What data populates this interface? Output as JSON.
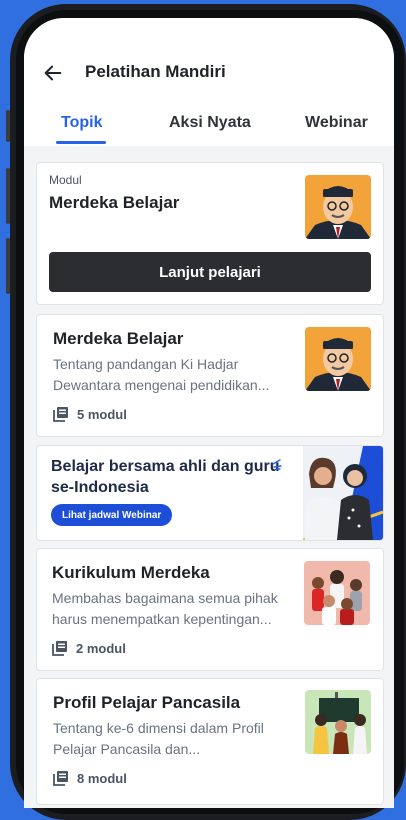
{
  "header": {
    "title": "Pelatihan Mandiri",
    "tabs": [
      {
        "label": "Topik",
        "active": true
      },
      {
        "label": "Aksi Nyata",
        "active": false
      },
      {
        "label": "Webinar",
        "active": false
      }
    ]
  },
  "continue_card": {
    "label": "Modul",
    "title": "Merdeka Belajar",
    "button_label": "Lanjut pelajari"
  },
  "topics": [
    {
      "title": "Merdeka Belajar",
      "description": "Tentang pandangan Ki Hadjar Dewantara mengenai pendidikan...",
      "modules": "5 modul",
      "icon": "book-stack-icon"
    },
    {
      "title": "Kurikulum Merdeka",
      "description": "Membahas bagaimana semua pihak harus menempatkan kepentingan...",
      "modules": "2 modul",
      "icon": "book-stack-icon"
    },
    {
      "title": "Profil Pelajar Pancasila",
      "description": "Tentang ke-6 dimensi dalam Profil Pelajar Pancasila dan...",
      "modules": "8 modul",
      "icon": "book-stack-icon"
    }
  ],
  "banner": {
    "title": "Belajar bersama ahli dan guru se-Indonesia",
    "button_label": "Lihat jadwal Webinar"
  },
  "colors": {
    "accent": "#2563eb",
    "dark_button": "#2b2d31",
    "background": "#2f6fe0"
  }
}
